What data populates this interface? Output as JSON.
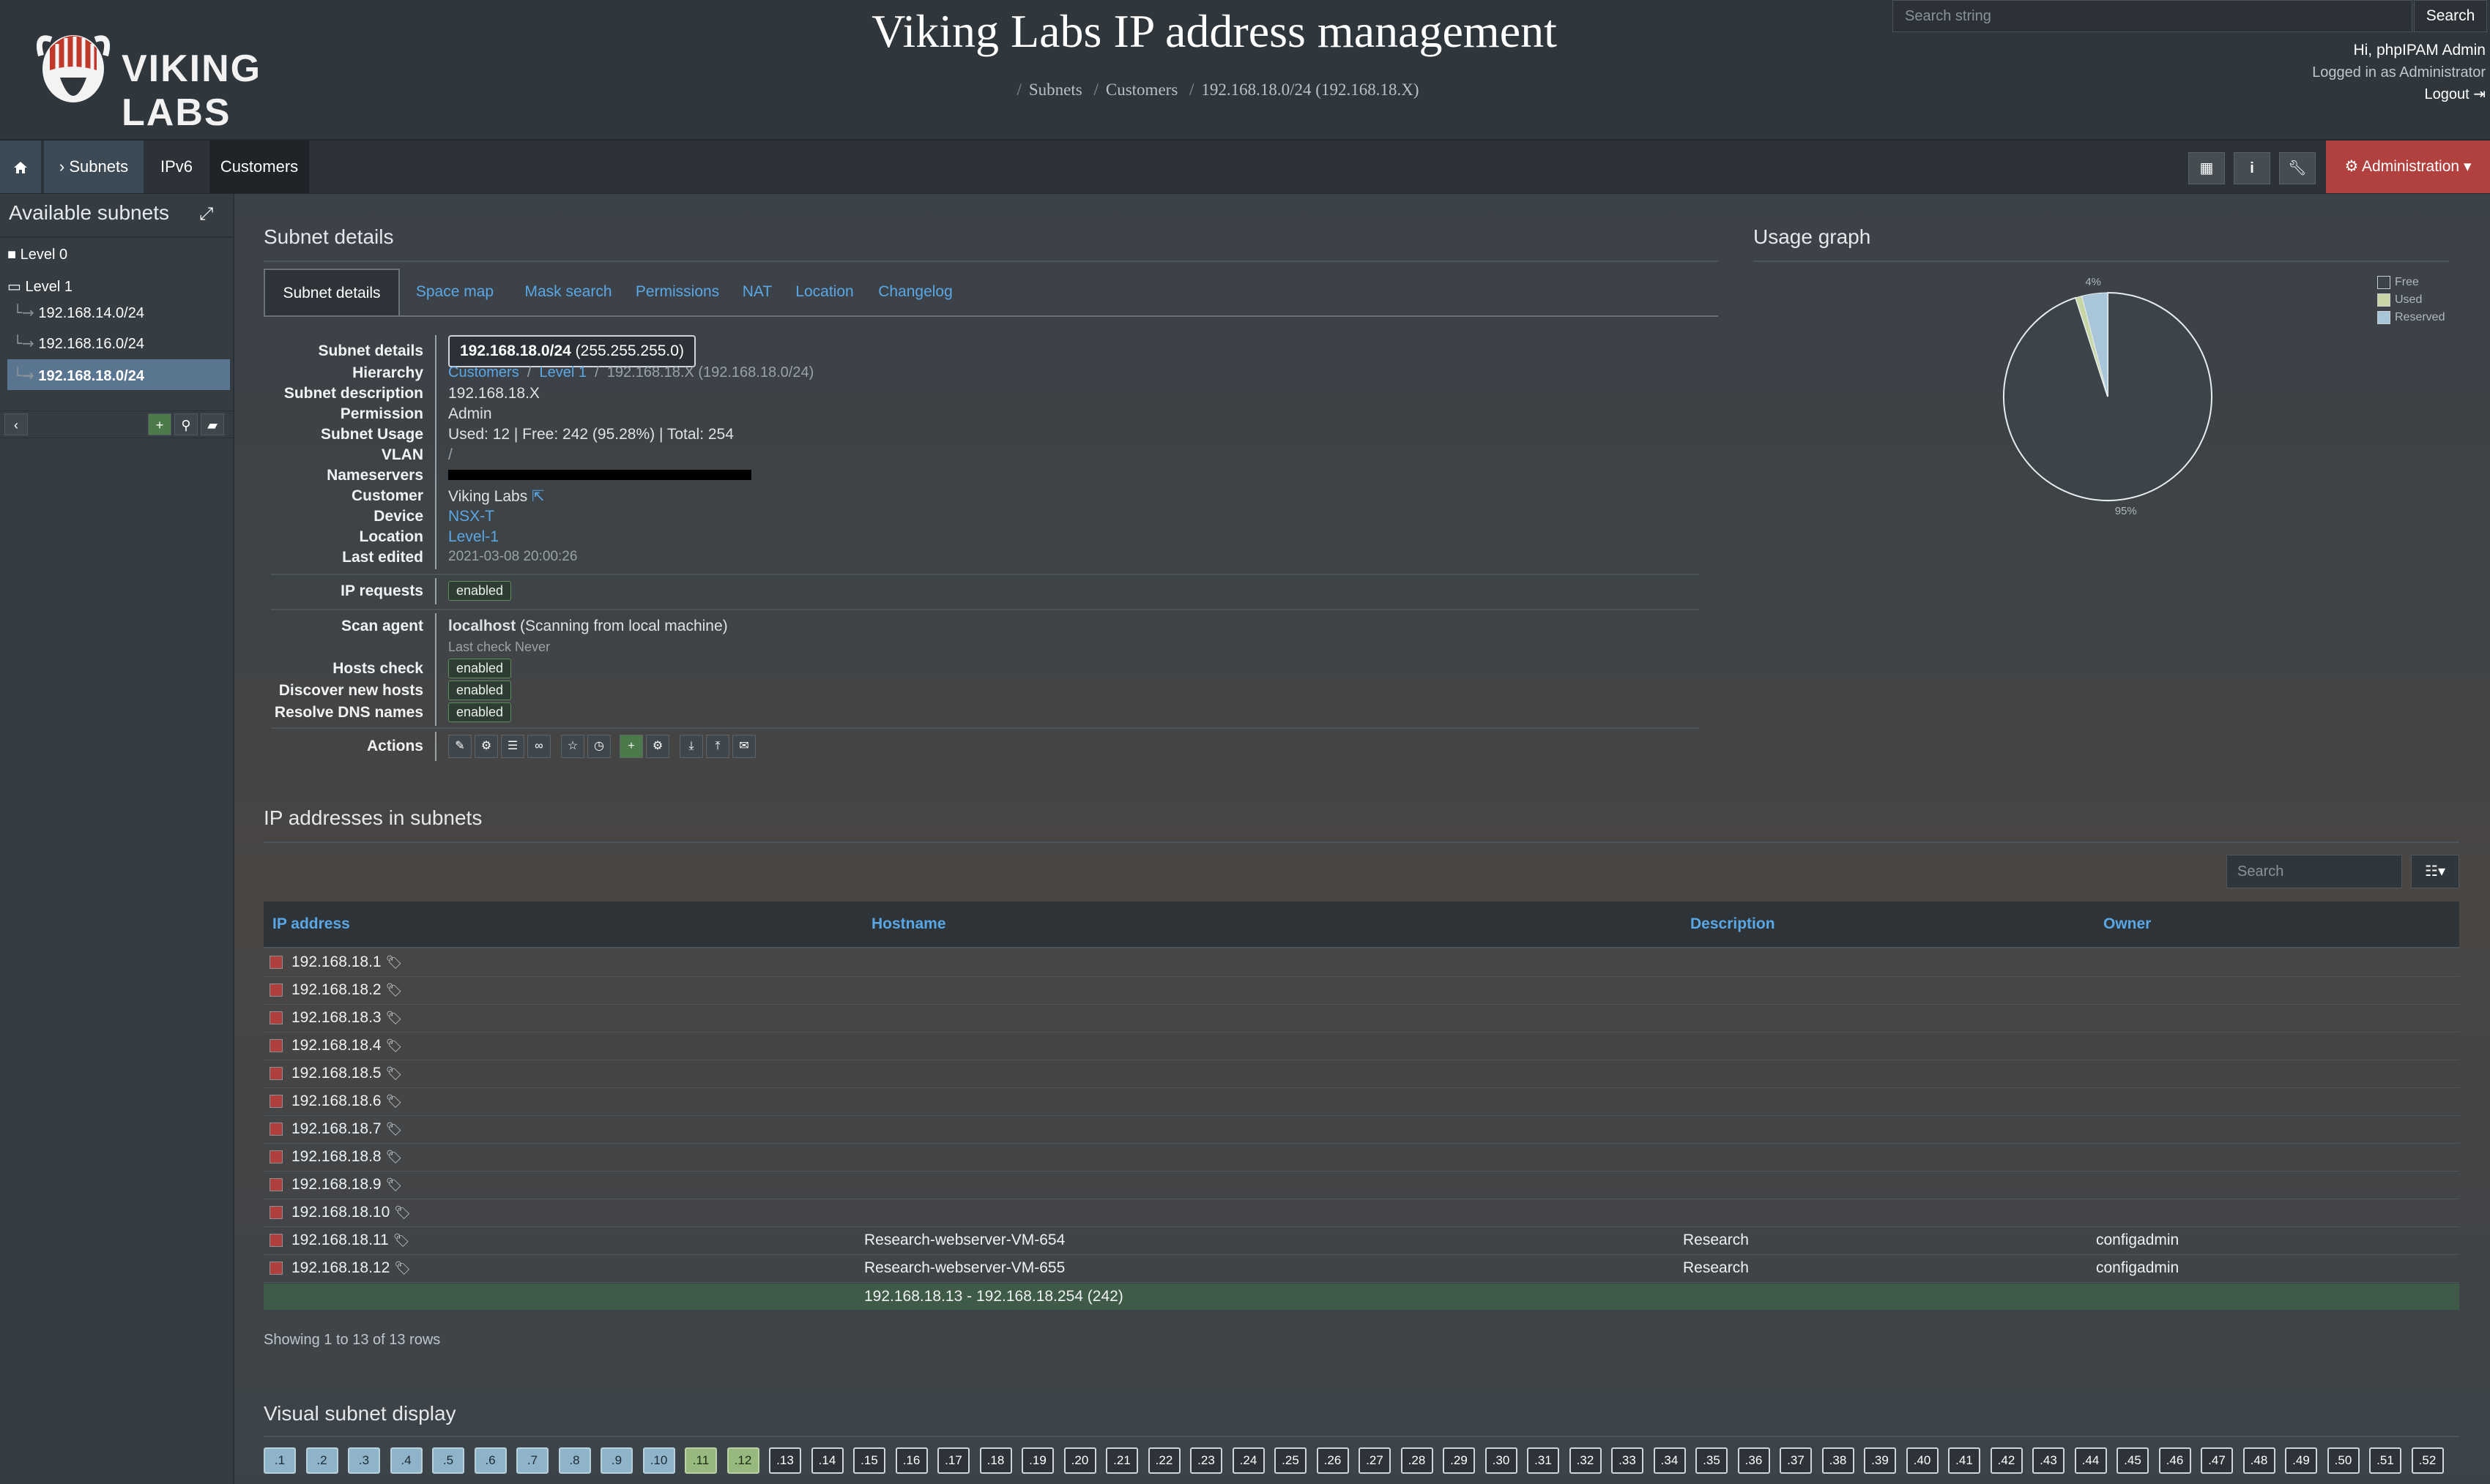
{
  "header": {
    "title": "Viking Labs IP address management",
    "logo_text": "VIKING LABS",
    "breadcrumb": [
      "Subnets",
      "Customers",
      "192.168.18.0/24 (192.168.18.X)"
    ],
    "search": {
      "placeholder": "Search string",
      "button": "Search"
    },
    "user": {
      "greeting": "Hi, phpIPAM Admin",
      "logged_in": "Logged in as  Administrator",
      "logout": "Logout"
    }
  },
  "nav": {
    "subnets": "Subnets",
    "ipv6": "IPv6",
    "customers": "Customers",
    "admin": "Administration",
    "icons": [
      "home-icon",
      "grid-icon",
      "info-icon",
      "wrench-icon",
      "gear-icon"
    ]
  },
  "sidebar": {
    "title": "Available subnets",
    "items": [
      {
        "label": "Level 0",
        "type": "folder"
      },
      {
        "label": "Level 1",
        "type": "folder-open"
      },
      {
        "label": "192.168.14.0/24"
      },
      {
        "label": "192.168.16.0/24"
      },
      {
        "label": "192.168.18.0/24",
        "selected": true
      }
    ]
  },
  "details": {
    "section_title": "Subnet details",
    "tabs": [
      "Subnet details",
      "Space map",
      "Mask search",
      "Permissions",
      "NAT",
      "Location",
      "Changelog"
    ],
    "subnet": "192.168.18.0/24",
    "mask": "(255.255.255.0)",
    "labels": {
      "subnet": "Subnet details",
      "hierarchy": "Hierarchy",
      "description": "Subnet description",
      "permission": "Permission",
      "usage": "Subnet Usage",
      "vlan": "VLAN",
      "nameservers": "Nameservers",
      "customer": "Customer",
      "device": "Device",
      "location": "Location",
      "last_edited": "Last edited",
      "ip_requests": "IP requests",
      "scan_agent": "Scan agent",
      "hosts_check": "Hosts check",
      "discover": "Discover new hosts",
      "resolve_dns": "Resolve DNS names",
      "actions": "Actions"
    },
    "hierarchy": [
      "Customers",
      "Level 1",
      "192.168.18.X (192.168.18.0/24)"
    ],
    "description": "192.168.18.X",
    "permission": "Admin",
    "usage": "Used: 12 | Free: 242 (95.28%) | Total: 254",
    "vlan": "/",
    "customer": "Viking Labs",
    "device": "NSX-T",
    "location": "Level-1",
    "last_edited": "2021-03-08 20:00:26",
    "ip_requests": "enabled",
    "scan_agent_name": "localhost",
    "scan_agent_desc": "(Scanning from local machine)",
    "last_check": "Last check Never",
    "hosts_check": "enabled",
    "discover": "enabled",
    "resolve_dns": "enabled",
    "action_icons": [
      "edit-icon",
      "settings-icon",
      "list-icon",
      "link-icon",
      "star-icon",
      "clock-icon",
      "add-icon",
      "scan-icon",
      "download-icon",
      "upload-icon",
      "mail-icon"
    ]
  },
  "graph": {
    "title": "Usage graph",
    "legend": [
      "Free",
      "Used",
      "Reserved"
    ],
    "colors": {
      "free": "#3b4449",
      "used": "#c8d6a6",
      "reserved": "#a9c6d8"
    },
    "chart_data": {
      "type": "pie",
      "labels": [
        "Free",
        "Used",
        "Reserved"
      ],
      "values": [
        95,
        1,
        4
      ],
      "slice_labels": [
        "95%",
        "",
        "4%"
      ]
    }
  },
  "ips": {
    "section_title": "IP addresses in subnets",
    "search_placeholder": "Search",
    "columns": [
      "IP address",
      "Hostname",
      "Description",
      "Owner"
    ],
    "rows": [
      {
        "ip": "192.168.18.1",
        "hostname": "",
        "description": "",
        "owner": ""
      },
      {
        "ip": "192.168.18.2",
        "hostname": "",
        "description": "",
        "owner": ""
      },
      {
        "ip": "192.168.18.3",
        "hostname": "",
        "description": "",
        "owner": ""
      },
      {
        "ip": "192.168.18.4",
        "hostname": "",
        "description": "",
        "owner": ""
      },
      {
        "ip": "192.168.18.5",
        "hostname": "",
        "description": "",
        "owner": ""
      },
      {
        "ip": "192.168.18.6",
        "hostname": "",
        "description": "",
        "owner": ""
      },
      {
        "ip": "192.168.18.7",
        "hostname": "",
        "description": "",
        "owner": ""
      },
      {
        "ip": "192.168.18.8",
        "hostname": "",
        "description": "",
        "owner": ""
      },
      {
        "ip": "192.168.18.9",
        "hostname": "",
        "description": "",
        "owner": ""
      },
      {
        "ip": "192.168.18.10",
        "hostname": "",
        "description": "",
        "owner": ""
      },
      {
        "ip": "192.168.18.11",
        "hostname": "Research-webserver-VM-654",
        "description": "Research",
        "owner": "configadmin"
      },
      {
        "ip": "192.168.18.12",
        "hostname": "Research-webserver-VM-655",
        "description": "Research",
        "owner": "configadmin"
      }
    ],
    "free_range": "192.168.18.13 - 192.168.18.254 (242)",
    "showing": "Showing 1 to 13 of 13 rows"
  },
  "visual": {
    "title": "Visual subnet display",
    "cells": [
      ".1",
      ".2",
      ".3",
      ".4",
      ".5",
      ".6",
      ".7",
      ".8",
      ".9",
      ".10",
      ".11",
      ".12",
      ".13",
      ".14",
      ".15",
      ".16",
      ".17",
      ".18",
      ".19",
      ".20",
      ".21",
      ".22",
      ".23",
      ".24",
      ".25",
      ".26",
      ".27",
      ".28",
      ".29",
      ".30",
      ".31",
      ".32",
      ".33",
      ".34",
      ".35",
      ".36",
      ".37",
      ".38",
      ".39",
      ".40",
      ".41",
      ".42",
      ".43",
      ".44",
      ".45",
      ".46",
      ".47",
      ".48",
      ".49",
      ".50",
      ".51",
      ".52"
    ]
  }
}
